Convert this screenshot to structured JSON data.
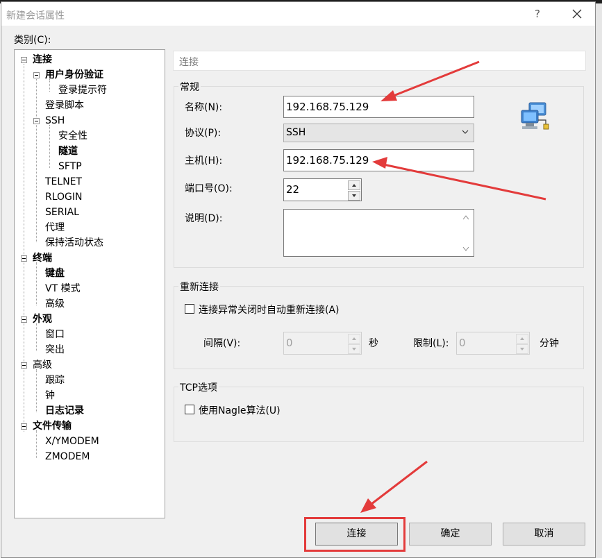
{
  "window": {
    "title": "新建会话属性",
    "help": "?"
  },
  "category_label": "类别(C):",
  "tree": [
    "连接",
    "用户身份验证",
    "登录提示符",
    "登录脚本",
    "SSH",
    "安全性",
    "隧道",
    "SFTP",
    "TELNET",
    "RLOGIN",
    "SERIAL",
    "代理",
    "保持活动状态",
    "终端",
    "键盘",
    "VT 模式",
    "高级",
    "外观",
    "窗口",
    "突出",
    "高级",
    "跟踪",
    "钟",
    "日志记录",
    "文件传输",
    "X/YMODEM",
    "ZMODEM"
  ],
  "panel": {
    "header": "连接",
    "general": {
      "title": "常规",
      "name_label": "名称(N):",
      "name_value": "192.168.75.129",
      "protocol_label": "协议(P):",
      "protocol_value": "SSH",
      "host_label": "主机(H):",
      "host_value": "192.168.75.129",
      "port_label": "端口号(O):",
      "port_value": "22",
      "desc_label": "说明(D):",
      "desc_value": ""
    },
    "reconnect": {
      "title": "重新连接",
      "auto_label": "连接异常关闭时自动重新连接(A)",
      "interval_label": "间隔(V):",
      "interval_value": "0",
      "interval_unit": "秒",
      "limit_label": "限制(L):",
      "limit_value": "0",
      "limit_unit": "分钟"
    },
    "tcp": {
      "title": "TCP选项",
      "nagle_label": "使用Nagle算法(U)"
    }
  },
  "buttons": {
    "connect": "连接",
    "ok": "确定",
    "cancel": "取消"
  },
  "colors": {
    "annotation": "#e33b3b",
    "dialog_bg": "#f0f0f0"
  },
  "icons": {
    "network": "network-computer-icon",
    "close": "close-icon",
    "dropdown": "chevron-down-icon"
  }
}
